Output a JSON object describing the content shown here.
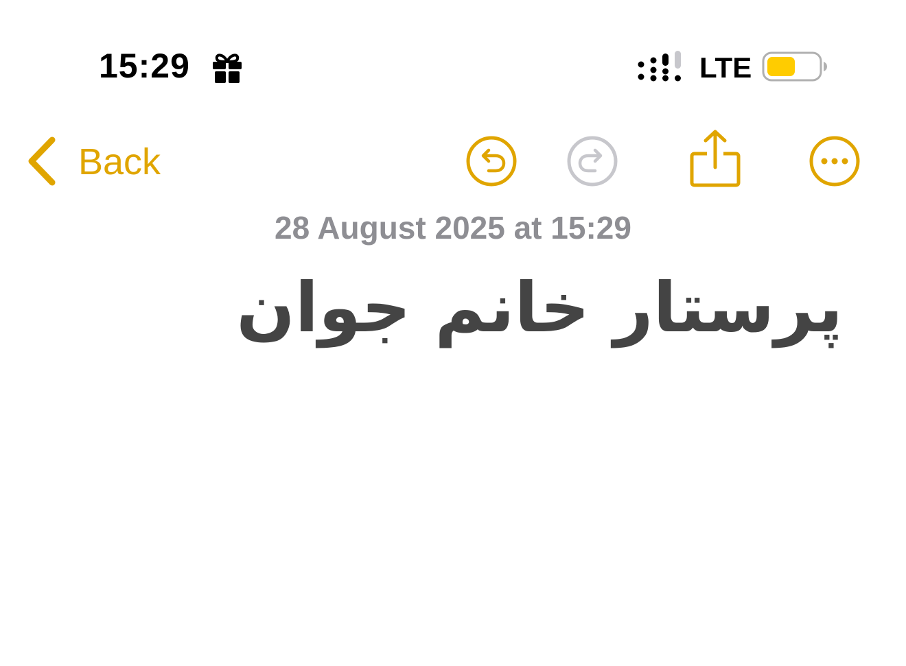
{
  "status_bar": {
    "time": "15:29",
    "network": "LTE",
    "icons": [
      "gift-icon",
      "signal-icon",
      "battery-icon"
    ],
    "battery_level": 0.55,
    "battery_color": "#FFCC00"
  },
  "nav": {
    "back_label": "Back",
    "icons": [
      "chevron-left-icon",
      "undo-icon",
      "redo-icon",
      "share-icon",
      "more-icon"
    ],
    "accent_color": "#E0A500",
    "disabled_color": "#C7C7CC"
  },
  "note": {
    "date": "28 August 2025 at 15:29",
    "title": "پرستار خانم جوان"
  }
}
